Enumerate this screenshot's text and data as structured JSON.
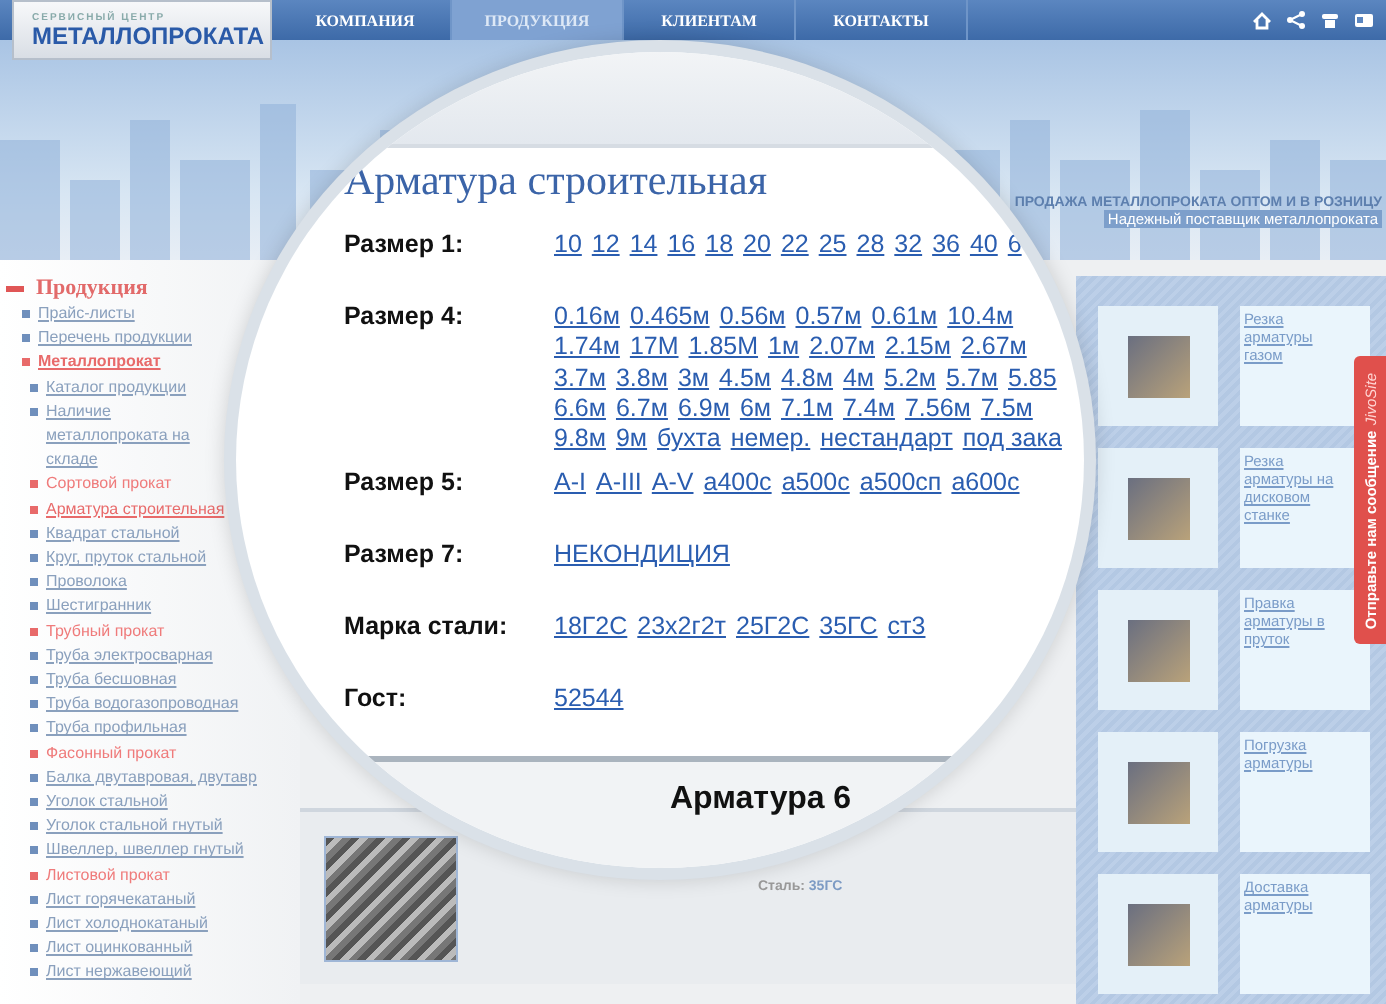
{
  "header": {
    "logo": {
      "small": "СЕРВИСНЫЙ ЦЕНТР",
      "big": "МЕТАЛЛОПРОКАТА"
    },
    "nav": [
      {
        "label": "КОМПАНИЯ",
        "selected": false
      },
      {
        "label": "ПРОДУКЦИЯ",
        "selected": true
      },
      {
        "label": "КЛИЕНТАМ",
        "selected": false
      },
      {
        "label": "КОНТАКТЫ",
        "selected": false
      }
    ]
  },
  "banner": {
    "headline": "ПРОДАЖА МЕТАЛЛОПРОКАТА ОПТОМ И В РОЗНИЦУ",
    "tagline": "Надежный поставщик металлопроката"
  },
  "sidebar": {
    "title": "Продукция",
    "expanded": true,
    "items": [
      {
        "label": "Прайс-листы",
        "selected": false
      },
      {
        "label": "Перечень продукции",
        "selected": false
      },
      {
        "label": "Металлопрокат",
        "selected": true,
        "children": [
          {
            "kind": "link",
            "label": "Каталог продукции",
            "selected": false
          },
          {
            "kind": "link",
            "label": "Наличие металлопроката на складе",
            "selected": false
          },
          {
            "kind": "category",
            "label": "Сортовой прокат",
            "selected": false
          },
          {
            "kind": "link",
            "label": "Арматура строительная",
            "selected": true
          },
          {
            "kind": "link",
            "label": "Квадрат стальной",
            "selected": false
          },
          {
            "kind": "link",
            "label": "Круг, пруток стальной",
            "selected": false
          },
          {
            "kind": "link",
            "label": "Проволока",
            "selected": false
          },
          {
            "kind": "link",
            "label": "Шестигранник",
            "selected": false
          },
          {
            "kind": "category",
            "label": "Трубный прокат",
            "selected": false
          },
          {
            "kind": "link",
            "label": "Труба электросварная",
            "selected": false
          },
          {
            "kind": "link",
            "label": "Труба бесшовная",
            "selected": false
          },
          {
            "kind": "link",
            "label": "Труба водогазопроводная",
            "selected": false
          },
          {
            "kind": "link",
            "label": "Труба профильная",
            "selected": false
          },
          {
            "kind": "category",
            "label": "Фасонный прокат",
            "selected": false
          },
          {
            "kind": "link",
            "label": "Балка двутавровая, двутавр",
            "selected": false
          },
          {
            "kind": "link",
            "label": "Уголок стальной",
            "selected": false
          },
          {
            "kind": "link",
            "label": "Уголок стальной гнутый",
            "selected": false
          },
          {
            "kind": "link",
            "label": "Швеллер, швеллер гнутый",
            "selected": false
          },
          {
            "kind": "category",
            "label": "Листовой прокат",
            "selected": false
          },
          {
            "kind": "link",
            "label": "Лист горячекатаный",
            "selected": false
          },
          {
            "kind": "link",
            "label": "Лист холоднокатаный",
            "selected": false
          },
          {
            "kind": "link",
            "label": "Лист оцинкованный",
            "selected": false
          },
          {
            "kind": "link",
            "label": "Лист нержавеющий",
            "selected": false
          }
        ]
      }
    ]
  },
  "product_card": {
    "steel_label": "Сталь:",
    "steel_value": "35ГС"
  },
  "magnifier": {
    "title": "Арматура строительная",
    "properties": [
      {
        "label": "Размер 1:",
        "lines": [
          [
            "10",
            "12",
            "14",
            "16",
            "18",
            "20",
            "22",
            "25",
            "28",
            "32",
            "36",
            "40",
            "6"
          ]
        ]
      },
      {
        "label": "Размер 4:",
        "lines": [
          [
            "0.16м",
            "0.465м",
            "0.56м",
            "0.57м",
            "0.61м",
            "10.4м"
          ],
          [
            "1.74м",
            "17М",
            "1.85М",
            "1м",
            "2.07м",
            "2.15м",
            "2.67м"
          ],
          [
            "3.7м",
            "3.8м",
            "3м",
            "4.5м",
            "4.8м",
            "4м",
            "5.2м",
            "5.7м",
            "5.85"
          ],
          [
            "6.6м",
            "6.7м",
            "6.9м",
            "6м",
            "7.1м",
            "7.4м",
            "7.56м",
            "7.5м"
          ],
          [
            "9.8м",
            "9м",
            "бухта",
            "немер.",
            "нестандарт",
            "под зака"
          ]
        ]
      },
      {
        "label": "Размер 5:",
        "lines": [
          [
            "A-I",
            "A-III",
            "A-V",
            "а400с",
            "а500с",
            "а500сп",
            "а600с"
          ]
        ]
      },
      {
        "label": "Размер 7:",
        "lines": [
          [
            "НЕКОНДИЦИЯ"
          ]
        ]
      },
      {
        "label": "Марка стали:",
        "lines": [
          [
            "18Г2С",
            "23х2г2т",
            "25Г2С",
            "35ГС",
            "ст3"
          ]
        ]
      },
      {
        "label": "Гост:",
        "lines": [
          [
            "52544"
          ]
        ]
      }
    ],
    "product_title": "Арматура 6"
  },
  "services": [
    {
      "label": "Резка арматуры газом"
    },
    {
      "label": "Резка арматуры на дисковом станке"
    },
    {
      "label": "Правка арматуры в пруток"
    },
    {
      "label": "Погрузка арматуры"
    },
    {
      "label": "Доставка арматуры"
    }
  ],
  "feedback_tab": {
    "label": "Отправьте нам сообщение",
    "brand": "JivoSite"
  }
}
